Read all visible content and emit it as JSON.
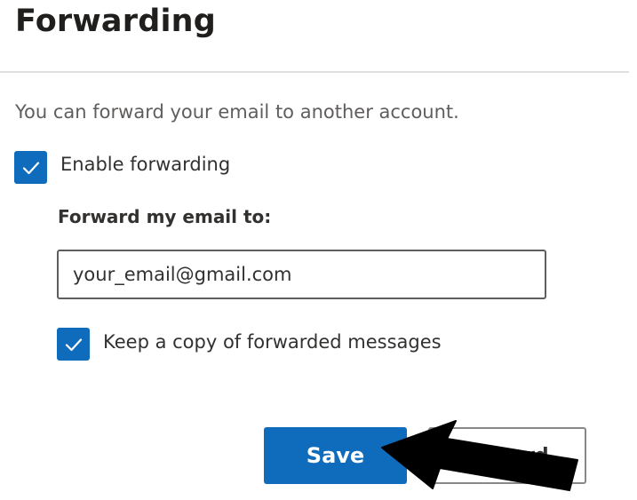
{
  "section": {
    "title": "Forwarding",
    "description": "You can forward your email to another account."
  },
  "forwarding": {
    "enable_label": "Enable forwarding",
    "enable_checked": true,
    "forward_to_label": "Forward my email to:",
    "email_value": "your_email@gmail.com",
    "keep_copy_label": "Keep a copy of forwarded messages",
    "keep_copy_checked": true
  },
  "actions": {
    "save_label": "Save",
    "discard_label": "Discard"
  },
  "colors": {
    "accent": "#0f6cbd",
    "arrow": "#000000"
  },
  "icons": {
    "checkmark": "checkmark-icon",
    "annotation_arrow": "arrow-pointer-icon"
  }
}
